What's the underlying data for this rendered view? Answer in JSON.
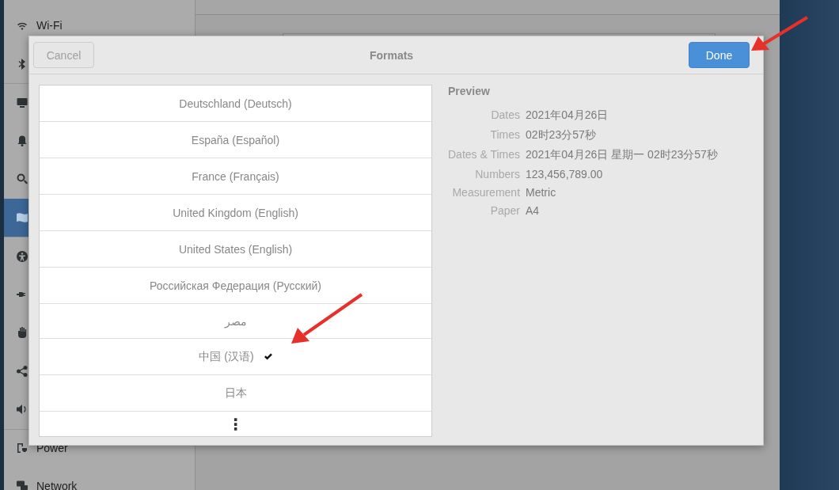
{
  "sidebar": {
    "items": [
      {
        "label": "Wi-Fi",
        "selected": false
      },
      {
        "selected": false
      },
      {
        "selected": false
      },
      {
        "selected": false
      },
      {
        "selected": false
      },
      {
        "selected": true
      },
      {
        "selected": false
      },
      {
        "selected": false
      },
      {
        "selected": false
      },
      {
        "selected": false
      },
      {
        "selected": false
      },
      {
        "label": "Power",
        "selected": false
      },
      {
        "label": "Network",
        "selected": false
      }
    ]
  },
  "dialog": {
    "title": "Formats",
    "cancel_button": "Cancel",
    "done_button": "Done",
    "regions": [
      {
        "label": "Deutschland (Deutsch)",
        "selected": false
      },
      {
        "label": "España (Español)",
        "selected": false
      },
      {
        "label": "France (Français)",
        "selected": false
      },
      {
        "label": "United Kingdom (English)",
        "selected": false
      },
      {
        "label": "United States (English)",
        "selected": false
      },
      {
        "label": "Российская Федерация (Русский)",
        "selected": false
      },
      {
        "label": "مصر",
        "selected": false
      },
      {
        "label": "中国 (汉语)",
        "selected": true
      },
      {
        "label": "日本",
        "selected": false
      }
    ],
    "more_button": "⋮",
    "preview": {
      "title": "Preview",
      "rows": [
        {
          "label": "Dates",
          "value": "2021年04月26日"
        },
        {
          "label": "Times",
          "value": "02时23分57秒"
        },
        {
          "label": "Dates & Times",
          "value": "2021年04月26日 星期一 02时23分57秒"
        },
        {
          "label": "Numbers",
          "value": "123,456,789.00"
        },
        {
          "label": "Measurement",
          "value": "Metric"
        },
        {
          "label": "Paper",
          "value": "A4"
        }
      ]
    }
  }
}
